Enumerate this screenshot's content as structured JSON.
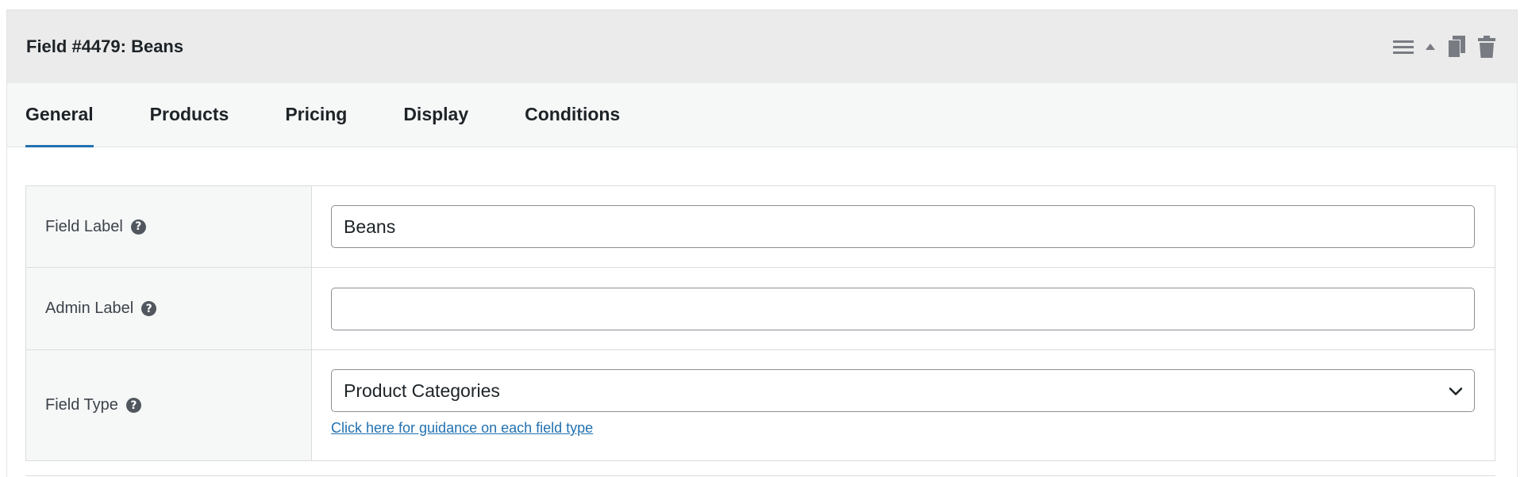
{
  "header": {
    "title": "Field #4479: Beans",
    "icons": [
      "menu-icon",
      "collapse-arrow-icon",
      "duplicate-icon",
      "trash-icon"
    ]
  },
  "tabs": [
    {
      "label": "General",
      "active": true
    },
    {
      "label": "Products",
      "active": false
    },
    {
      "label": "Pricing",
      "active": false
    },
    {
      "label": "Display",
      "active": false
    },
    {
      "label": "Conditions",
      "active": false
    }
  ],
  "form": {
    "field_label": {
      "label": "Field Label",
      "value": "Beans"
    },
    "admin_label": {
      "label": "Admin Label",
      "value": ""
    },
    "field_type": {
      "label": "Field Type",
      "selected": "Product Categories",
      "guide_link": "Click here for guidance on each field type"
    },
    "help_glyph": "?"
  },
  "colors": {
    "accent": "#2271b1",
    "header_bg": "#ebebeb",
    "tabs_bg": "#f6f7f7",
    "border": "#dcdcde"
  }
}
